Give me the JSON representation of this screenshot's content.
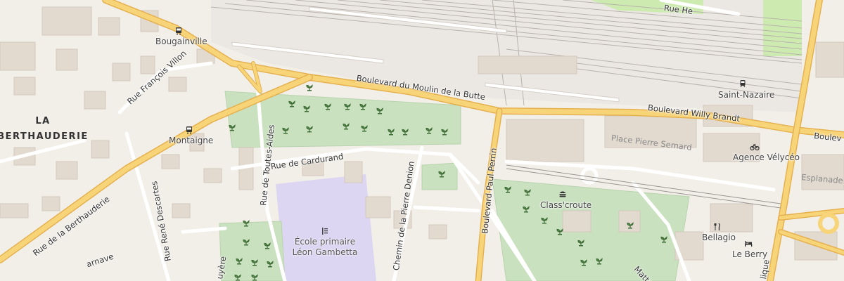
{
  "map": {
    "district": {
      "line1": "LA",
      "line2": "BERTHAUDERIE"
    },
    "places": {
      "bougainville": "Bougainville",
      "montaigne": "Montaigne",
      "saint_nazaire": "Saint-Nazaire",
      "agence_velyceo": "Agence Vélycéo",
      "class_croute": "Class'croute",
      "bellagio": "Bellagio",
      "le_berry": "Le Berry"
    },
    "school": {
      "line1": "École primaire",
      "line2": "Léon Gambetta"
    },
    "streets": {
      "boulevard_moulin": "Boulevard du Moulin de la Butte",
      "boulevard_willy_brandt": "Boulevard Willy Brandt",
      "boulevard_edge": "Boulev",
      "rue_he": "Rue He",
      "rue_francois_villon": "Rue François Villon",
      "rue_toutes_aides": "Rue de Toutes-Aides",
      "rue_cardurand": "Rue de Cardurand",
      "rue_rene_descartes": "Rue René Descartes",
      "rue_berthauderie": "Rue de la Berthauderie",
      "chemin_pierre_denion": "Chemin de la Pierre Denion",
      "boulevard_paul_perrin": "Boulevard Paul Perrin",
      "place_pierre_semard": "Place Pierre Semard",
      "esplanade": "Esplanade",
      "matte": "Matte",
      "lique": "lique",
      "uyere": "uyère",
      "arnave": "arnave"
    },
    "icons": {
      "bus_stop": "bus-stop-icon",
      "train_station": "train-station-icon",
      "bicycle_rental": "bicycle-icon",
      "fast_food": "fast-food-icon",
      "restaurant": "restaurant-icon",
      "hotel": "hotel-icon",
      "school": "school-icon",
      "allotment": "allotment-garden-icon"
    },
    "colors": {
      "background": "#f2efe9",
      "railway_area": "#ebe7e2",
      "major_road": "#f8d478",
      "major_road_casing": "#e5b150",
      "minor_road": "#ffffff",
      "allotment_green": "#c9e1bf",
      "school_purple": "#ddd6f2",
      "building": "#e2d9cf",
      "park_green": "#cdebb0"
    }
  }
}
